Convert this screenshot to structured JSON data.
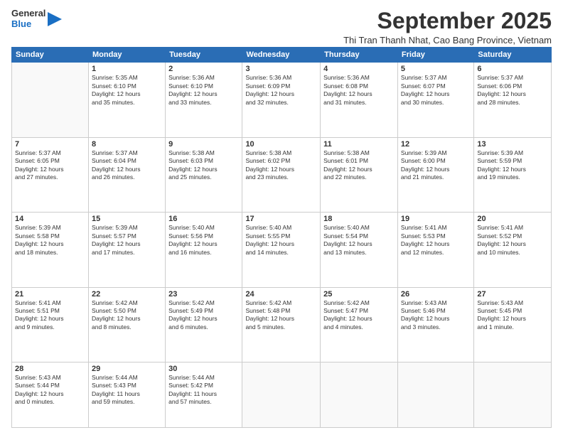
{
  "header": {
    "logo_general": "General",
    "logo_blue": "Blue",
    "title": "September 2025",
    "subtitle": "Thi Tran Thanh Nhat, Cao Bang Province, Vietnam"
  },
  "calendar": {
    "days_of_week": [
      "Sunday",
      "Monday",
      "Tuesday",
      "Wednesday",
      "Thursday",
      "Friday",
      "Saturday"
    ],
    "weeks": [
      [
        {
          "day": "",
          "info": ""
        },
        {
          "day": "1",
          "info": "Sunrise: 5:35 AM\nSunset: 6:10 PM\nDaylight: 12 hours\nand 35 minutes."
        },
        {
          "day": "2",
          "info": "Sunrise: 5:36 AM\nSunset: 6:10 PM\nDaylight: 12 hours\nand 33 minutes."
        },
        {
          "day": "3",
          "info": "Sunrise: 5:36 AM\nSunset: 6:09 PM\nDaylight: 12 hours\nand 32 minutes."
        },
        {
          "day": "4",
          "info": "Sunrise: 5:36 AM\nSunset: 6:08 PM\nDaylight: 12 hours\nand 31 minutes."
        },
        {
          "day": "5",
          "info": "Sunrise: 5:37 AM\nSunset: 6:07 PM\nDaylight: 12 hours\nand 30 minutes."
        },
        {
          "day": "6",
          "info": "Sunrise: 5:37 AM\nSunset: 6:06 PM\nDaylight: 12 hours\nand 28 minutes."
        }
      ],
      [
        {
          "day": "7",
          "info": "Sunrise: 5:37 AM\nSunset: 6:05 PM\nDaylight: 12 hours\nand 27 minutes."
        },
        {
          "day": "8",
          "info": "Sunrise: 5:37 AM\nSunset: 6:04 PM\nDaylight: 12 hours\nand 26 minutes."
        },
        {
          "day": "9",
          "info": "Sunrise: 5:38 AM\nSunset: 6:03 PM\nDaylight: 12 hours\nand 25 minutes."
        },
        {
          "day": "10",
          "info": "Sunrise: 5:38 AM\nSunset: 6:02 PM\nDaylight: 12 hours\nand 23 minutes."
        },
        {
          "day": "11",
          "info": "Sunrise: 5:38 AM\nSunset: 6:01 PM\nDaylight: 12 hours\nand 22 minutes."
        },
        {
          "day": "12",
          "info": "Sunrise: 5:39 AM\nSunset: 6:00 PM\nDaylight: 12 hours\nand 21 minutes."
        },
        {
          "day": "13",
          "info": "Sunrise: 5:39 AM\nSunset: 5:59 PM\nDaylight: 12 hours\nand 19 minutes."
        }
      ],
      [
        {
          "day": "14",
          "info": "Sunrise: 5:39 AM\nSunset: 5:58 PM\nDaylight: 12 hours\nand 18 minutes."
        },
        {
          "day": "15",
          "info": "Sunrise: 5:39 AM\nSunset: 5:57 PM\nDaylight: 12 hours\nand 17 minutes."
        },
        {
          "day": "16",
          "info": "Sunrise: 5:40 AM\nSunset: 5:56 PM\nDaylight: 12 hours\nand 16 minutes."
        },
        {
          "day": "17",
          "info": "Sunrise: 5:40 AM\nSunset: 5:55 PM\nDaylight: 12 hours\nand 14 minutes."
        },
        {
          "day": "18",
          "info": "Sunrise: 5:40 AM\nSunset: 5:54 PM\nDaylight: 12 hours\nand 13 minutes."
        },
        {
          "day": "19",
          "info": "Sunrise: 5:41 AM\nSunset: 5:53 PM\nDaylight: 12 hours\nand 12 minutes."
        },
        {
          "day": "20",
          "info": "Sunrise: 5:41 AM\nSunset: 5:52 PM\nDaylight: 12 hours\nand 10 minutes."
        }
      ],
      [
        {
          "day": "21",
          "info": "Sunrise: 5:41 AM\nSunset: 5:51 PM\nDaylight: 12 hours\nand 9 minutes."
        },
        {
          "day": "22",
          "info": "Sunrise: 5:42 AM\nSunset: 5:50 PM\nDaylight: 12 hours\nand 8 minutes."
        },
        {
          "day": "23",
          "info": "Sunrise: 5:42 AM\nSunset: 5:49 PM\nDaylight: 12 hours\nand 6 minutes."
        },
        {
          "day": "24",
          "info": "Sunrise: 5:42 AM\nSunset: 5:48 PM\nDaylight: 12 hours\nand 5 minutes."
        },
        {
          "day": "25",
          "info": "Sunrise: 5:42 AM\nSunset: 5:47 PM\nDaylight: 12 hours\nand 4 minutes."
        },
        {
          "day": "26",
          "info": "Sunrise: 5:43 AM\nSunset: 5:46 PM\nDaylight: 12 hours\nand 3 minutes."
        },
        {
          "day": "27",
          "info": "Sunrise: 5:43 AM\nSunset: 5:45 PM\nDaylight: 12 hours\nand 1 minute."
        }
      ],
      [
        {
          "day": "28",
          "info": "Sunrise: 5:43 AM\nSunset: 5:44 PM\nDaylight: 12 hours\nand 0 minutes."
        },
        {
          "day": "29",
          "info": "Sunrise: 5:44 AM\nSunset: 5:43 PM\nDaylight: 11 hours\nand 59 minutes."
        },
        {
          "day": "30",
          "info": "Sunrise: 5:44 AM\nSunset: 5:42 PM\nDaylight: 11 hours\nand 57 minutes."
        },
        {
          "day": "",
          "info": ""
        },
        {
          "day": "",
          "info": ""
        },
        {
          "day": "",
          "info": ""
        },
        {
          "day": "",
          "info": ""
        }
      ]
    ]
  }
}
